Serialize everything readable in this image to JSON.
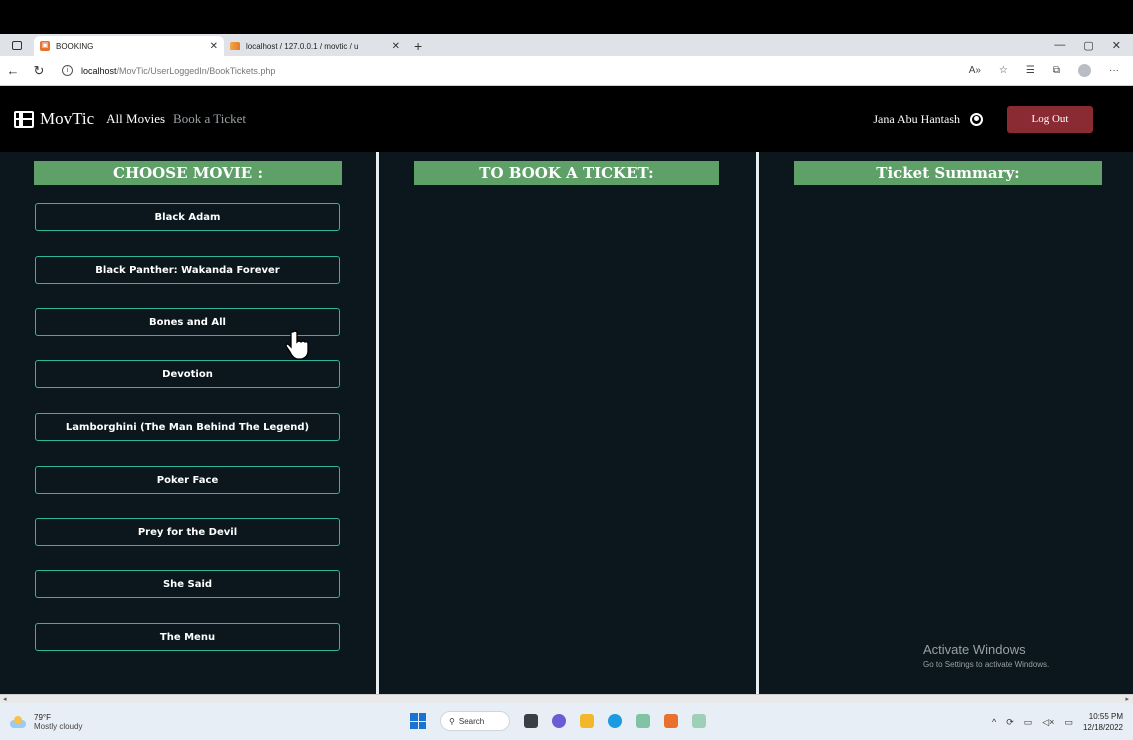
{
  "browser": {
    "tabs": [
      {
        "title": "BOOKING",
        "active": true
      },
      {
        "title": "localhost / 127.0.0.1 / movtic / u",
        "active": false
      }
    ],
    "new_tab": "+",
    "url_host": "localhost",
    "url_path": "/MovTic/UserLoggedIn/BookTickets.php"
  },
  "navbar": {
    "brand": "MovTic",
    "links": [
      "All Movies",
      "Book a Ticket"
    ],
    "user_name": "Jana Abu Hantash",
    "logout_label": "Log Out"
  },
  "columns": {
    "choose_heading": "CHOOSE MOVIE :",
    "book_heading": "TO BOOK A TICKET:",
    "summary_heading": "Ticket Summary:"
  },
  "movies": [
    "Black Adam",
    "Black Panther: Wakanda Forever",
    "Bones and All",
    "Devotion",
    "Lamborghini (The Man Behind The Legend)",
    "Poker Face",
    "Prey for the Devil",
    "She Said",
    "The Menu"
  ],
  "watermark": {
    "title": "Activate Windows",
    "subtitle": "Go to Settings to activate Windows."
  },
  "taskbar": {
    "temperature": "79°F",
    "condition": "Mostly cloudy",
    "search_label": "Search",
    "time": "10:55 PM",
    "date": "12/18/2022"
  },
  "colors": {
    "heading_bg": "#5f9f68",
    "button_border": "#2fb59a",
    "logout_bg": "#8a2a32",
    "page_bg": "#0b171c"
  }
}
